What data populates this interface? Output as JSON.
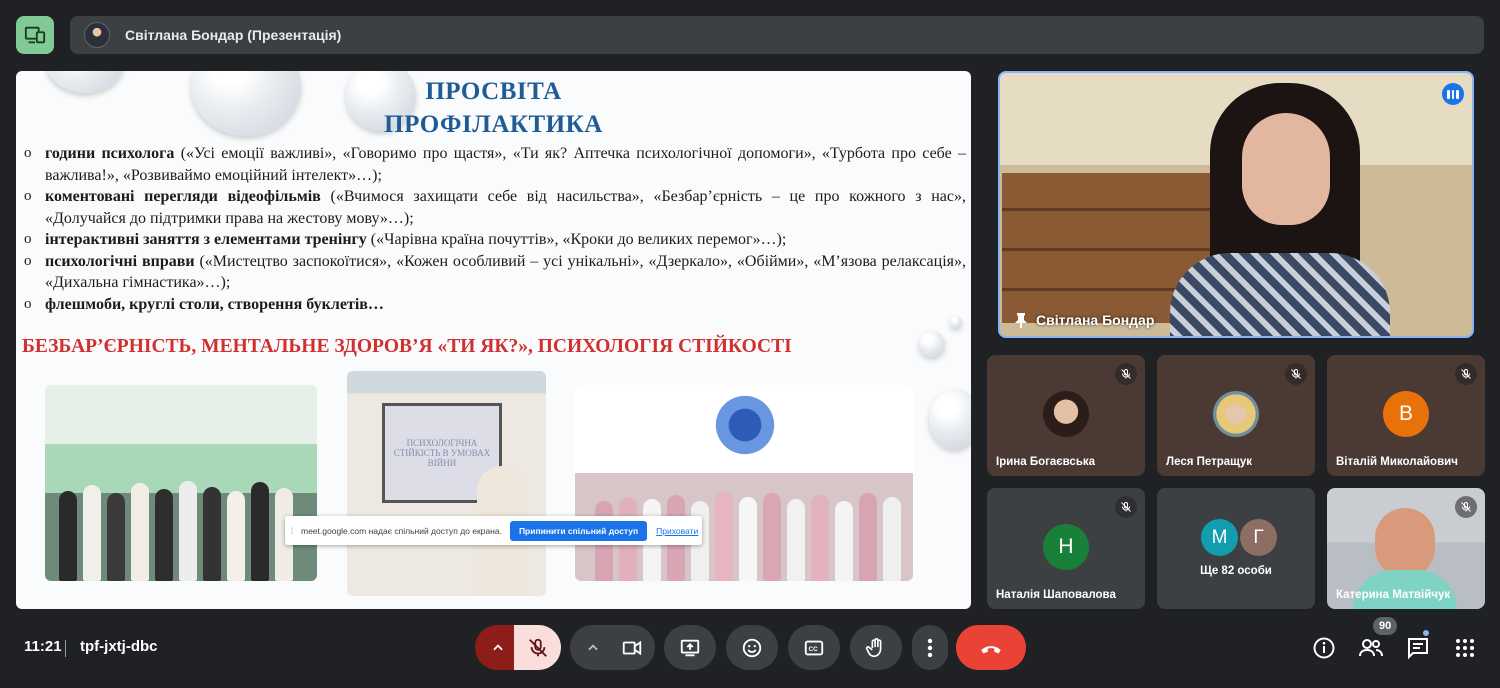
{
  "topbar": {
    "presenter_label": "Світлана Бондар (Презентація)"
  },
  "slide": {
    "title_line1": "ПРОСВІТА",
    "title_line2": "ПРОФІЛАКТИКА",
    "bullets": [
      {
        "bold": "години психолога",
        "text": " («Усі емоції важливі», «Говоримо про щастя», «Ти як? Аптечка психологічної допомоги», «Турбота про себе – важлива!», «Розвиваймо емоційний інтелект»…);"
      },
      {
        "bold": "коментовані перегляди відеофільмів",
        "text": " («Вчимося захищати себе від насильства», «Безбар’єрність – це про кожного з нас», «Долучайся до підтримки права на жестову мову»…);"
      },
      {
        "bold": "інтерактивні заняття з елементами тренінгу",
        "text": " («Чарівна країна почуттів», «Кроки до великих перемог»…);"
      },
      {
        "bold": "психологічні вправи",
        "text": " («Мистецтво заспокоїтися», «Кожен особливий – усі унікальні», «Дзеркало», «Обійми», «М’язова релаксація», «Дихальна гімнастика»…);"
      },
      {
        "bold": "флешмоби, круглі столи, створення буклетів…",
        "text": ""
      }
    ],
    "headline": "БЕЗБАР’ЄРНІСТЬ, МЕНТАЛЬНЕ ЗДОРОВ’Я «ТИ ЯК?», ПСИХОЛОГІЯ СТІЙКОСТІ",
    "board_text": "ПСИХОЛОГІЧНА СТІЙКІСТЬ В УМОВАХ ВІЙНИ"
  },
  "share_popup": {
    "message": "meet.google.com надає спільний доступ до екрана.",
    "stop_label": "Припинити спільний доступ",
    "hide_label": "Приховати"
  },
  "speaker": {
    "name": "Світлана Бондар"
  },
  "participants": [
    {
      "name": "Ірина Богаєвська",
      "initial": ""
    },
    {
      "name": "Леся Петращук",
      "initial": ""
    },
    {
      "name": "Віталій Миколайович",
      "initial": "В"
    },
    {
      "name": "Наталія Шаповалова",
      "initial": "Н"
    },
    {
      "name": "Катерина Матвійчук",
      "initial": ""
    }
  ],
  "more": {
    "initial_1": "М",
    "initial_2": "Г",
    "label": "Ще 82 особи"
  },
  "bottombar": {
    "time": "11:21",
    "meeting_code": "tpf-jxtj-dbc",
    "people_count": "90"
  },
  "colors": {
    "accent_green": "#81c995",
    "hangup_red": "#ea4335",
    "avatar_orange": "#e8710a",
    "avatar_green": "#188038",
    "avatar_teal": "#129eaf",
    "avatar_brown": "#8d6e63"
  },
  "icons": [
    "companion-mode-icon",
    "mic-off-icon",
    "camera-icon",
    "present-icon",
    "emoji-icon",
    "captions-icon",
    "raise-hand-icon",
    "more-options-icon",
    "hang-up-icon",
    "info-icon",
    "people-icon",
    "chat-icon",
    "activities-icon",
    "pin-icon",
    "speaking-indicator-icon"
  ]
}
